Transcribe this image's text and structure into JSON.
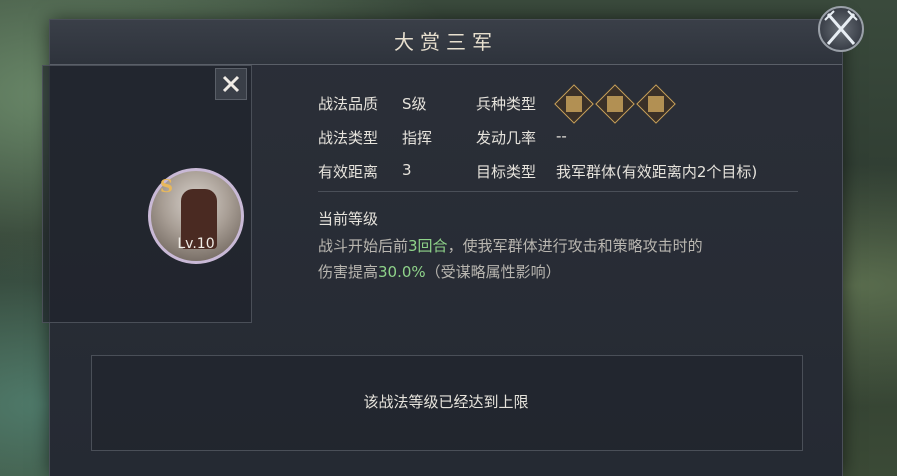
{
  "title": "大赏三军",
  "skill_card": {
    "grade_letter": "S",
    "level_label": "Lv.10"
  },
  "info": {
    "quality_label": "战法品质",
    "quality_value": "S级",
    "type_label": "战法类型",
    "type_value": "指挥",
    "range_label": "有效距离",
    "range_value": "3",
    "troop_label": "兵种类型",
    "troop_icons": [
      "bow-troop-icon",
      "shield-troop-icon",
      "cavalry-troop-icon"
    ],
    "rate_label": "发动几率",
    "rate_value": "--",
    "target_label": "目标类型",
    "target_value": "我军群体(有效距离内2个目标)"
  },
  "current_level": {
    "heading": "当前等级",
    "line1_a": "战斗开始后前",
    "line1_hl": "3回合",
    "line1_b": "，使我军群体进行攻击和策略攻击时的",
    "line2_a": "伤害提高",
    "line2_hl": "30.0%",
    "line2_b": "（受谋略属性影响）"
  },
  "footer": {
    "max_level_text": "该战法等级已经达到上限"
  },
  "colors": {
    "highlight": "#8fd38a",
    "gold": "#c8a15a",
    "text": "#e6e3dc"
  }
}
